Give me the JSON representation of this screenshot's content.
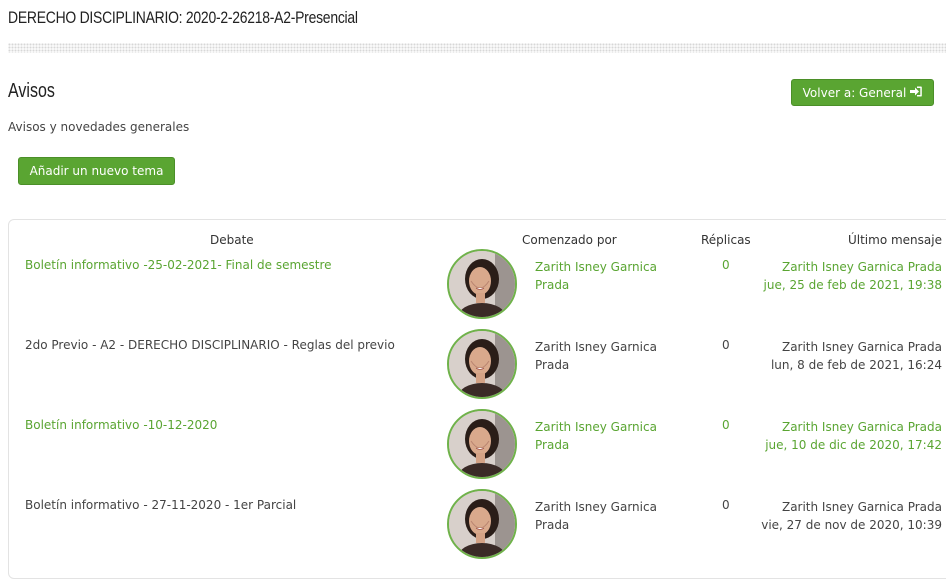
{
  "course": {
    "title": "DERECHO DISCIPLINARIO: 2020-2-26218-A2-Presencial"
  },
  "forum": {
    "heading": "Avisos",
    "description": "Avisos y novedades generales",
    "back_button": "Volver a: General",
    "add_button": "Añadir un nuevo tema"
  },
  "table": {
    "headers": {
      "debate": "Debate",
      "started_by": "Comenzado por",
      "replies": "Réplicas",
      "last_post": "Último mensaje"
    },
    "rows": [
      {
        "topic": "Boletín informativo -25-02-2021- Final de semestre",
        "author_line1": "Zarith Isney Garnica",
        "author_line2": "Prada",
        "replies": "0",
        "last_author": "Zarith Isney Garnica Prada",
        "last_date": "jue, 25 de feb de 2021, 19:38",
        "style": "green"
      },
      {
        "topic": "2do Previo - A2 - DERECHO DISCIPLINARIO - Reglas del previo",
        "author_line1": "Zarith Isney Garnica",
        "author_line2": "Prada",
        "replies": "0",
        "last_author": "Zarith Isney Garnica Prada",
        "last_date": "lun, 8 de feb de 2021, 16:24",
        "style": "plain"
      },
      {
        "topic": "Boletín informativo -10-12-2020",
        "author_line1": "Zarith Isney Garnica",
        "author_line2": "Prada",
        "replies": "0",
        "last_author": "Zarith Isney Garnica Prada",
        "last_date": "jue, 10 de dic de 2020, 17:42",
        "style": "green"
      },
      {
        "topic": "Boletín informativo - 27-11-2020 - 1er Parcial",
        "author_line1": "Zarith Isney Garnica",
        "author_line2": "Prada",
        "replies": "0",
        "last_author": "Zarith Isney Garnica Prada",
        "last_date": "vie, 27 de nov de 2020, 10:39",
        "style": "plain"
      }
    ]
  },
  "icons": {
    "back_button_icon": "sign-in-arrow-icon",
    "avatar": "user-photo-avatar"
  },
  "colors": {
    "accent": "#5aa532",
    "accent_border": "#4b8f28",
    "text": "#444444"
  }
}
